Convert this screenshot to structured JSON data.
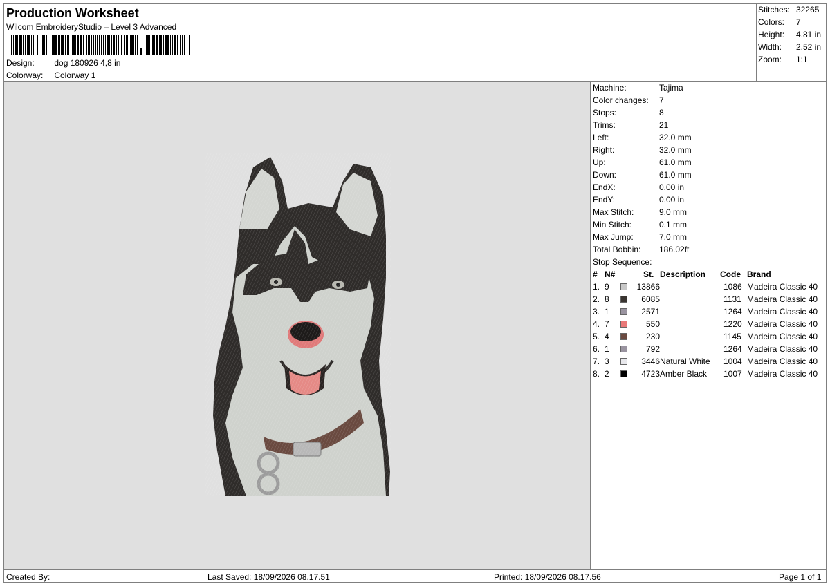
{
  "header": {
    "title": "Production Worksheet",
    "subtitle": "Wilcom EmbroideryStudio – Level 3 Advanced",
    "design_label": "Design:",
    "design_value": "dog 180926 4,8 in",
    "colorway_label": "Colorway:",
    "colorway_value": "Colorway 1"
  },
  "stats": {
    "stitches_label": "Stitches:",
    "stitches": "32265",
    "colors_label": "Colors:",
    "colors": "7",
    "height_label": "Height:",
    "height": "4.81 in",
    "width_label": "Width:",
    "width": "2.52 in",
    "zoom_label": "Zoom:",
    "zoom": "1:1"
  },
  "machine": {
    "rows": [
      {
        "label": "Machine:",
        "value": "Tajima"
      },
      {
        "label": "Color changes:",
        "value": "7"
      },
      {
        "label": "Stops:",
        "value": "8"
      },
      {
        "label": "Trims:",
        "value": "21"
      },
      {
        "label": "Left:",
        "value": "32.0 mm"
      },
      {
        "label": "Right:",
        "value": "32.0 mm"
      },
      {
        "label": "Up:",
        "value": "61.0 mm"
      },
      {
        "label": "Down:",
        "value": "61.0 mm"
      },
      {
        "label": "EndX:",
        "value": "0.00 in"
      },
      {
        "label": "EndY:",
        "value": "0.00 in"
      },
      {
        "label": "Max Stitch:",
        "value": "9.0 mm"
      },
      {
        "label": "Min Stitch:",
        "value": "0.1 mm"
      },
      {
        "label": "Max Jump:",
        "value": "7.0 mm"
      },
      {
        "label": "Total Bobbin:",
        "value": "186.02ft"
      }
    ],
    "stop_sequence_label": "Stop Sequence:"
  },
  "stop_table": {
    "headers": {
      "num": "#",
      "n": "N#",
      "st": "St.",
      "description": "Description",
      "code": "Code",
      "brand": "Brand"
    },
    "rows": [
      {
        "num": "1.",
        "n": "9",
        "color": "#c8c8c8",
        "st": "13866",
        "description": "",
        "code": "1086",
        "brand": "Madeira Classic 40"
      },
      {
        "num": "2.",
        "n": "8",
        "color": "#3a3531",
        "st": "6085",
        "description": "",
        "code": "1131",
        "brand": "Madeira Classic 40"
      },
      {
        "num": "3.",
        "n": "1",
        "color": "#9a94a0",
        "st": "2571",
        "description": "",
        "code": "1264",
        "brand": "Madeira Classic 40"
      },
      {
        "num": "4.",
        "n": "7",
        "color": "#e87878",
        "st": "550",
        "description": "",
        "code": "1220",
        "brand": "Madeira Classic 40"
      },
      {
        "num": "5.",
        "n": "4",
        "color": "#6a4a40",
        "st": "230",
        "description": "",
        "code": "1145",
        "brand": "Madeira Classic 40"
      },
      {
        "num": "6.",
        "n": "1",
        "color": "#9a94a0",
        "st": "792",
        "description": "",
        "code": "1264",
        "brand": "Madeira Classic 40"
      },
      {
        "num": "7.",
        "n": "3",
        "color": "#e8e8ec",
        "st": "3446",
        "description": "Natural White",
        "code": "1004",
        "brand": "Madeira Classic 40"
      },
      {
        "num": "8.",
        "n": "2",
        "color": "#000000",
        "st": "4723",
        "description": "Amber Black",
        "code": "1007",
        "brand": "Madeira Classic 40"
      }
    ]
  },
  "footer": {
    "created_by": "Created By:",
    "last_saved": "Last Saved: 18/09/2026 08.17.51",
    "printed": "Printed: 18/09/2026 08.17.56",
    "page": "Page 1 of 1"
  }
}
